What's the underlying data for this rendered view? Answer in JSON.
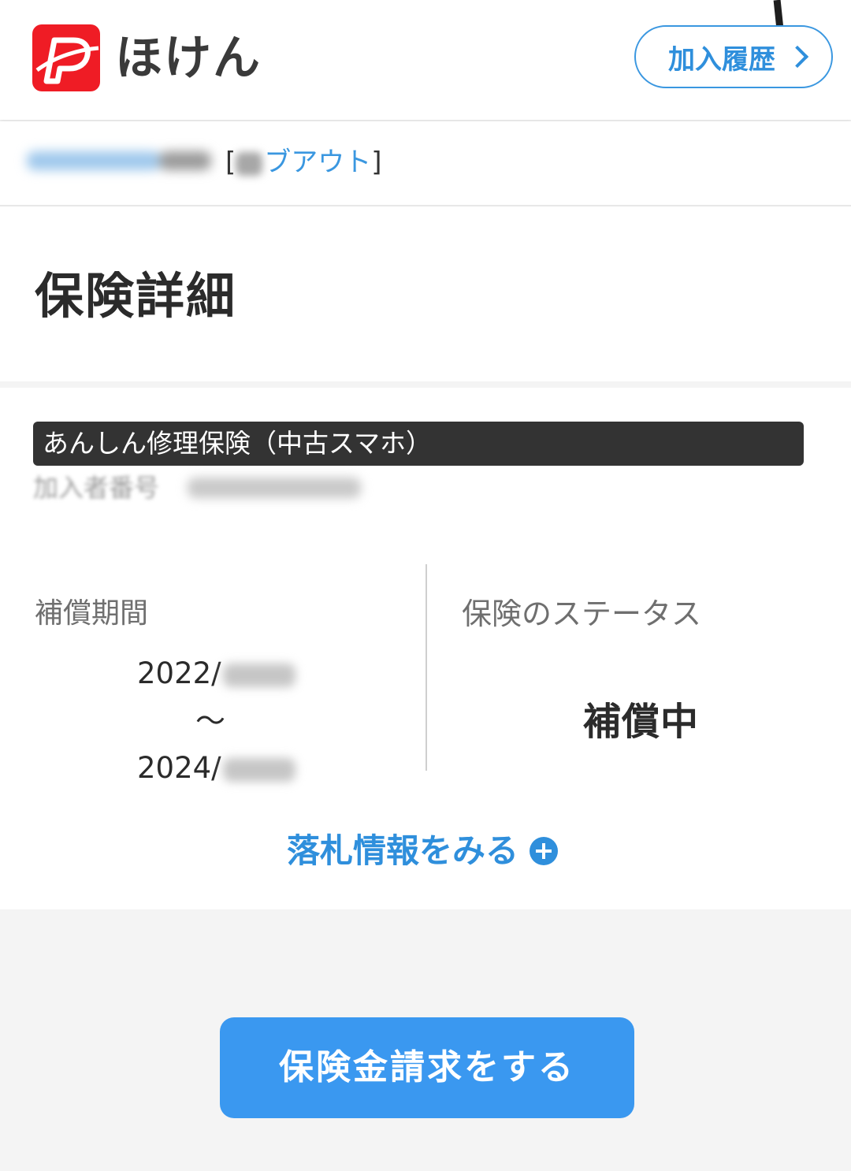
{
  "header": {
    "logo_text": "ほけん",
    "history_button_label": "加入履歴"
  },
  "user": {
    "logout_bracket_open": "[",
    "logout_label": "ブアウト",
    "logout_bracket_close": "]"
  },
  "page_title": "保険詳細",
  "policy": {
    "plan_name": "あんしん修理保険（中古スマホ）",
    "member_number_label": "加入者番号",
    "period_label": "補償期間",
    "period_start": "2022/",
    "period_separator": "〜",
    "period_end": "2024/",
    "status_label": "保険のステータス",
    "status_value": "補償中",
    "auction_link_label": "落札情報をみる"
  },
  "claim_button_label": "保険金請求をする",
  "colors": {
    "brand_red": "#ef1c25",
    "accent_blue": "#2f8fdc",
    "button_blue": "#3a98f0",
    "plan_bar": "#333333"
  },
  "icons": {
    "logo": "paypay-logo-icon",
    "history_chevron": "chevron-right-icon",
    "auction_plus": "plus-circle-icon"
  }
}
